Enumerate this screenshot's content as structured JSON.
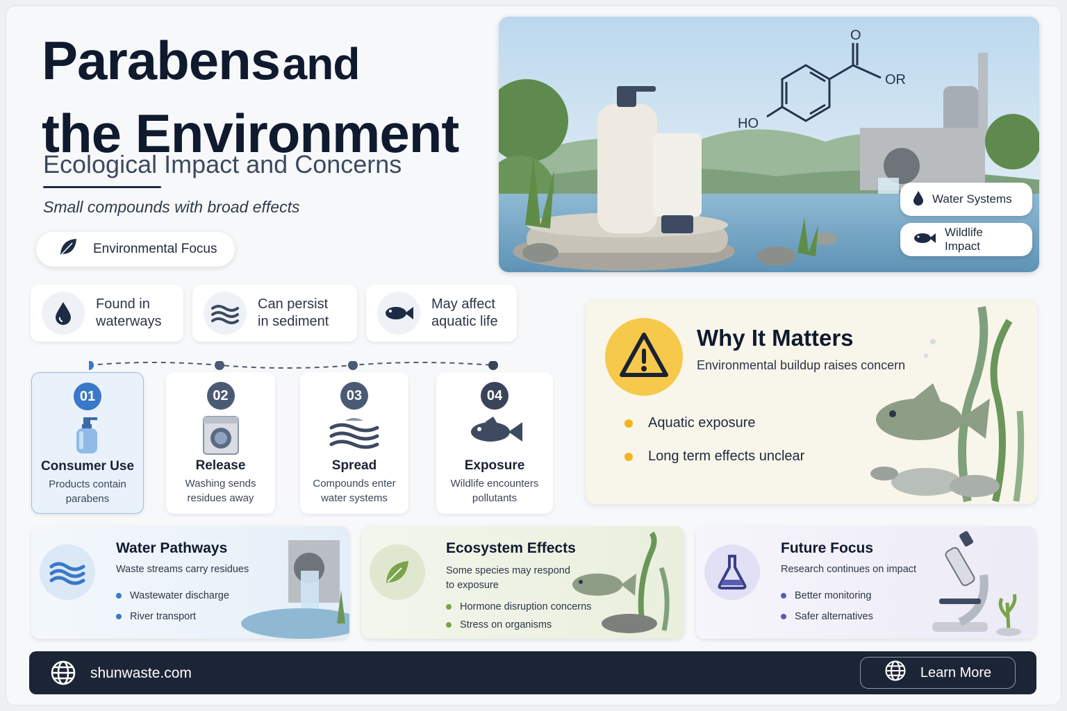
{
  "header": {
    "title_line1_a": "Parabens",
    "title_line1_b": "and",
    "title_line2": "the Environment",
    "subtitle": "Ecological Impact and Concerns",
    "tagline": "Small compounds with broad effects",
    "focus_pill": "Environmental Focus"
  },
  "hero": {
    "molecule_ho": "HO",
    "molecule_o": "O",
    "molecule_or": "OR",
    "tags": [
      "Water Systems",
      "Wildlife Impact"
    ]
  },
  "stats": [
    {
      "text": "Found in\nwaterways",
      "icon": "water-drop-icon"
    },
    {
      "text": "Can persist\nin sediment",
      "icon": "sediment-waves-icon"
    },
    {
      "text": "May affect\naquatic life",
      "icon": "fish-icon"
    }
  ],
  "steps": [
    {
      "num": "01",
      "name": "Consumer Use",
      "desc": "Products contain\nparabens",
      "icon": "pump-bottle-icon"
    },
    {
      "num": "02",
      "name": "Release",
      "desc": "Washing sends\nresidues away",
      "icon": "washing-machine-icon"
    },
    {
      "num": "03",
      "name": "Spread",
      "desc": "Compounds enter\nwater systems",
      "icon": "waves-icon"
    },
    {
      "num": "04",
      "name": "Exposure",
      "desc": "Wildlife encounters\npollutants",
      "icon": "fish-icon"
    }
  ],
  "why": {
    "title": "Why It Matters",
    "subtitle": "Environmental buildup raises concern",
    "bullets": [
      "Aquatic exposure",
      "Long term effects unclear"
    ]
  },
  "cards": [
    {
      "title": "Water Pathways",
      "desc": "Waste streams carry residues",
      "items": [
        "Wastewater discharge",
        "River transport"
      ]
    },
    {
      "title": "Ecosystem Effects",
      "desc": "Some species may respond\nto exposure",
      "items": [
        "Hormone disruption concerns",
        "Stress on organisms"
      ]
    },
    {
      "title": "Future Focus",
      "desc": "Research continues on impact",
      "items": [
        "Better monitoring",
        "Safer alternatives"
      ]
    }
  ],
  "footer": {
    "site": "shunwaste.com",
    "button": "Learn More"
  },
  "colors": {
    "navy": "#1c2536",
    "accent_blue": "#3a78c8",
    "warning_yellow": "#f7c94a",
    "green": "#7aa34a",
    "purple": "#5a5cb0"
  }
}
